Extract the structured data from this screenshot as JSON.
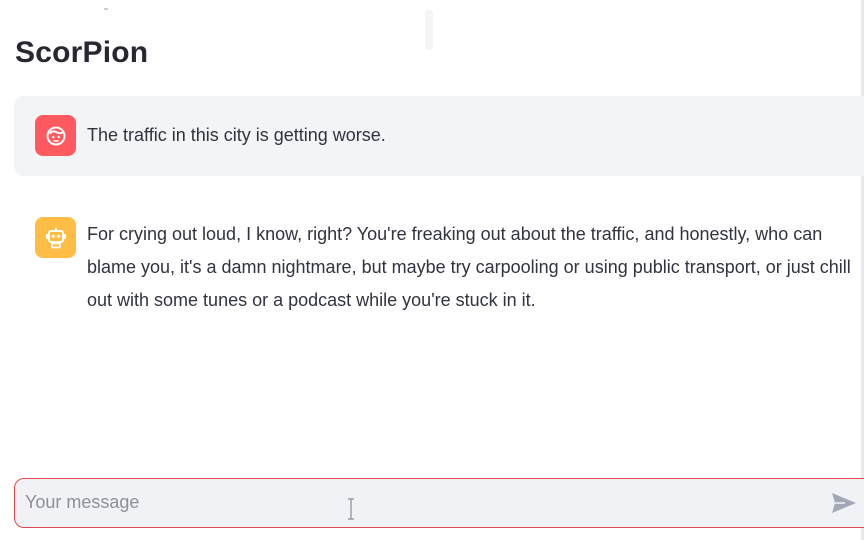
{
  "app": {
    "title": "ScorPion"
  },
  "messages": [
    {
      "role": "user",
      "avatar_icon": "user-face-icon",
      "avatar_color": "#ff5a5f",
      "text": "The traffic in this city is getting worse."
    },
    {
      "role": "assistant",
      "avatar_icon": "robot-icon",
      "avatar_color": "#ffbd45",
      "text": "For crying out loud, I know, right? You're freaking out about the traffic, and honestly, who can blame you, it's a damn nightmare, but maybe try carpooling or using public transport, or just chill out with some tunes or a podcast while you're stuck in it."
    }
  ],
  "chat_input": {
    "placeholder": "Your message",
    "value": "",
    "send_icon": "send-icon",
    "border_color": "#e34850"
  }
}
